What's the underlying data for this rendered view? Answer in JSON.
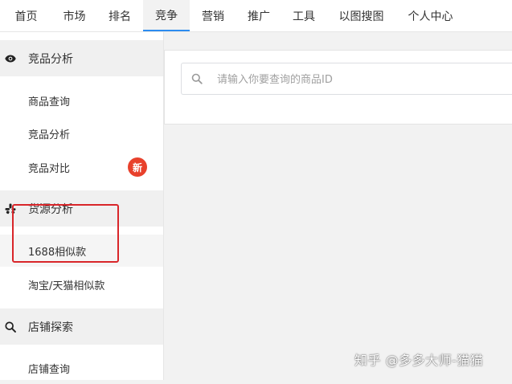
{
  "topnav": {
    "tabs": [
      {
        "label": "首页"
      },
      {
        "label": "市场"
      },
      {
        "label": "排名"
      },
      {
        "label": "竞争"
      },
      {
        "label": "营销"
      },
      {
        "label": "推广"
      },
      {
        "label": "工具"
      },
      {
        "label": "以图搜图"
      },
      {
        "label": "个人中心"
      }
    ],
    "active_tab": "竞争"
  },
  "sidebar": {
    "sections": [
      {
        "label": "竞品分析",
        "icon": "eye-icon",
        "items": [
          {
            "label": "商品查询"
          },
          {
            "label": "竞品分析"
          },
          {
            "label": "竞品对比",
            "badge": "新"
          }
        ]
      },
      {
        "label": "货源分析",
        "icon": "yelp-burst-icon",
        "items": [
          {
            "label": "1688相似款"
          },
          {
            "label": "淘宝/天猫相似款"
          }
        ]
      },
      {
        "label": "店铺探索",
        "icon": "search-icon",
        "items": [
          {
            "label": "店铺查询"
          }
        ]
      }
    ]
  },
  "main": {
    "search_placeholder": "请输入你要查询的商品ID"
  },
  "watermark": "知乎 @多多大师-猫猫",
  "colors": {
    "accent": "#2d8cf0",
    "badge": "#e8412c",
    "highlight_box": "#d9262a",
    "page_bg": "#f2f2f2"
  }
}
